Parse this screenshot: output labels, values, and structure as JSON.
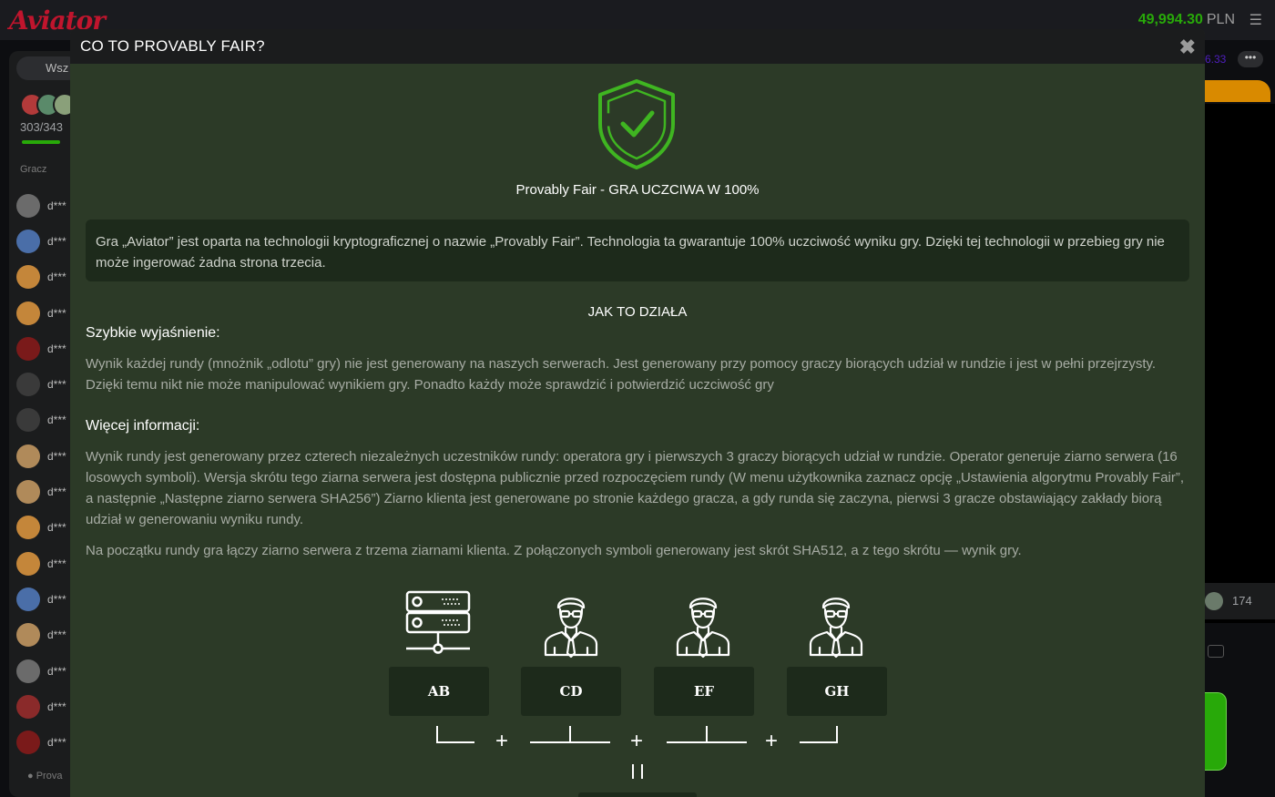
{
  "app": {
    "logo": "Aviator",
    "balance": "49,994.30",
    "currency": "PLN"
  },
  "left_panel": {
    "filter_tab": "Wsz",
    "count": "303/343",
    "column_header": "Gracz",
    "players": [
      "d***",
      "d***",
      "d***",
      "d***",
      "d***",
      "d***",
      "d***",
      "d***",
      "d***",
      "d***",
      "d***",
      "d***",
      "d***",
      "d***",
      "d***",
      "d***"
    ],
    "footer": "Prova"
  },
  "right_panel": {
    "multiplier": "6.33",
    "dots": "•••",
    "count": "174"
  },
  "modal": {
    "title": "CO TO PROVABLY FAIR?",
    "close": "✖",
    "shield_title": "Provably Fair - GRA UCZCIWA W 100%",
    "intro": "Gra „Aviator” jest oparta na technologii kryptograficznej o nazwie „Provably Fair”. Technologia ta gwarantuje 100% uczciwość wyniku gry. Dzięki tej technologii w przebieg gry nie może ingerować żadna strona trzecia.",
    "how_title": "JAK TO DZIAŁA",
    "quick_heading": "Szybkie wyjaśnienie:",
    "quick_text": "Wynik każdej rundy (mnożnik „odlotu” gry) nie jest generowany na naszych serwerach. Jest generowany przy pomocy graczy biorących udział w rundzie i jest w pełni przejrzysty. Dzięki temu nikt nie może manipulować wynikiem gry. Ponadto każdy może sprawdzić i potwierdzić uczciwość gry",
    "more_heading": "Więcej informacji:",
    "more_text_1": "Wynik rundy jest generowany przez czterech niezależnych uczestników rundy: operatora gry i pierwszych 3 graczy biorących udział w rundzie. Operator generuje ziarno serwera (16 losowych symboli). Wersja skrótu tego ziarna serwera jest dostępna publicznie przed rozpoczęciem rundy (W menu użytkownika zaznacz opcję „Ustawienia algorytmu Provably Fair”, a następnie „Następne ziarno serwera SHA256”) Ziarno klienta jest generowane po stronie każdego gracza, a gdy runda się zaczyna, pierwsi 3 gracze obstawiający zakłady biorą udział w generowaniu wyniku rundy.",
    "more_text_2": "Na początku rundy gra łączy ziarno serwera z trzema ziarnami klienta. Z połączonych symboli generowany jest skrót SHA512, a z tego skrótu — wynik gry.",
    "diagram": {
      "seeds": [
        "AB",
        "CD",
        "EF",
        "GH"
      ],
      "plus": "+",
      "icons": [
        "server-icon",
        "player-icon",
        "player-icon",
        "player-icon"
      ]
    }
  },
  "colors": {
    "modal_bg": "#2c3a27",
    "modal_header": "#1b1c1d",
    "accent_green": "#28a909",
    "shield_green": "#3fb521",
    "logo_red": "#c0152d"
  }
}
